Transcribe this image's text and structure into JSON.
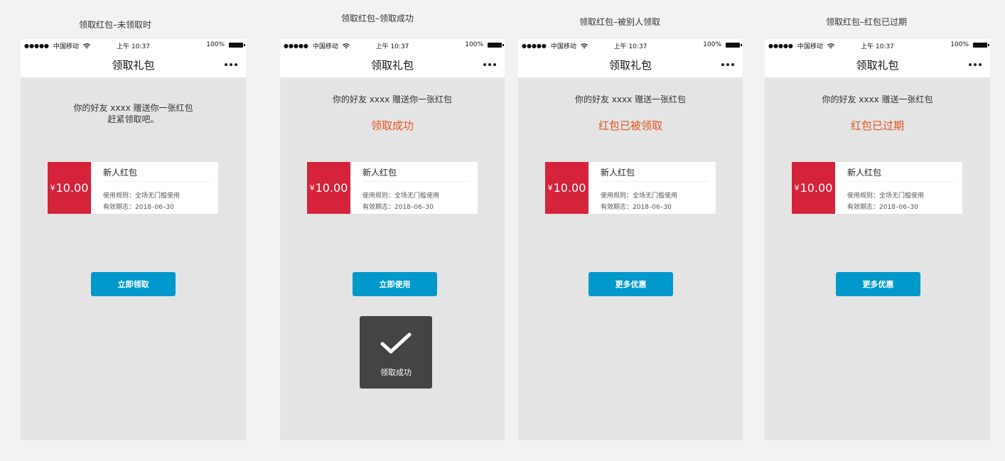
{
  "screens": [
    {
      "caption": "领取红包–未领取时",
      "status_bar": {
        "carrier": "中国移动",
        "time": "上午 10:37",
        "battery": "100%"
      },
      "nav_title": "领取礼包",
      "message_line1": "你的好友 xxxx 赠送你一张红包",
      "message_line2": "赶紧领取吧。",
      "coupon": {
        "currency": "¥",
        "amount": "10.00",
        "name": "新人红包",
        "rule": "使用规则：全场无门槛使用",
        "valid": "有效期志：2018–06–30"
      },
      "button_label": "立即领取"
    },
    {
      "caption": "领取红包–领取成功",
      "status_bar": {
        "carrier": "中国移动",
        "time": "上午 10:37",
        "battery": "100%"
      },
      "nav_title": "领取礼包",
      "message_line1": "你的好友 xxxx 赠送你一张红包",
      "status_text": "领取成功",
      "coupon": {
        "currency": "¥",
        "amount": "10.00",
        "name": "新人红包",
        "rule": "使用规则：全场无门槛使用",
        "valid": "有效期志：2018–06–30"
      },
      "button_label": "立即使用",
      "toast_text": "领取成功"
    },
    {
      "caption": "领取红包–被别人领取",
      "status_bar": {
        "carrier": "中国移动",
        "time": "上午 10:37",
        "battery": "100%"
      },
      "nav_title": "领取礼包",
      "message_line1": "你的好友 xxxx 赠送一张红包",
      "status_text": "红包已被领取",
      "coupon": {
        "currency": "¥",
        "amount": "10.00",
        "name": "新人红包",
        "rule": "使用规则：全场无门槛使用",
        "valid": "有效期志：2018–06–30"
      },
      "button_label": "更多优惠"
    },
    {
      "caption": "领取红包–红包已过期",
      "status_bar": {
        "carrier": "中国移动",
        "time": "上午 10:37",
        "battery": "100%"
      },
      "nav_title": "领取礼包",
      "message_line1": "你的好友 xxxx 赠送一张红包",
      "status_text": "红包已过期",
      "coupon": {
        "currency": "¥",
        "amount": "10.00",
        "name": "新人红包",
        "rule": "使用规则：全场无门槛使用",
        "valid": "有效期志：2018–06–30"
      },
      "button_label": "更多优惠"
    }
  ],
  "colors": {
    "coupon_red": "#d4233a",
    "button_blue": "#0199cc",
    "status_orange": "#e0541e",
    "toast_bg": "#444444"
  },
  "icons": {
    "more": "more-dots-icon",
    "wifi": "wifi-icon",
    "battery": "battery-icon",
    "check": "checkmark-icon"
  }
}
